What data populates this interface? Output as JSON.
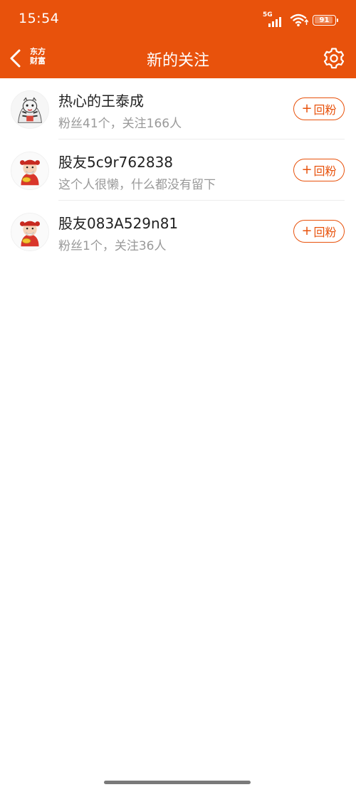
{
  "status_bar": {
    "time": "15:54",
    "network": "5G",
    "battery": "91"
  },
  "header": {
    "logo_line1": "东方",
    "logo_line2": "财富",
    "title": "新的关注"
  },
  "follow_button_label": "回粉",
  "followers": [
    {
      "name": "热心的王泰成",
      "subtitle": "粉丝41个，关注166人"
    },
    {
      "name": "股友5c9r762838",
      "subtitle": "这个人很懒，什么都没有留下"
    },
    {
      "name": "股友083A529n81",
      "subtitle": "粉丝1个，关注36人"
    }
  ],
  "colors": {
    "accent": "#e8520c",
    "primary_text": "#222222",
    "secondary_text": "#999999"
  },
  "icons": [
    "back-arrow-icon",
    "settings-gear-icon",
    "wifi-icon",
    "signal-icon",
    "battery-icon"
  ]
}
